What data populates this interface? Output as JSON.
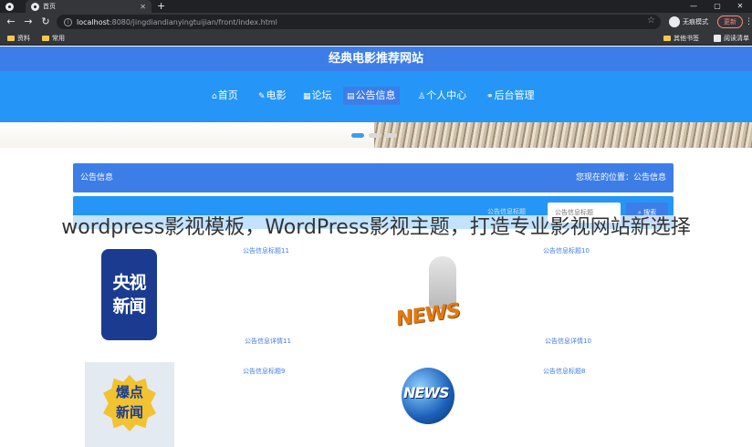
{
  "browser": {
    "tabs": [
      {
        "title": "",
        "active": false
      },
      {
        "title": "首页",
        "active": true
      }
    ],
    "new_tab_glyph": "+",
    "window_controls": [
      "—",
      "▢",
      "✕"
    ],
    "url_host": "localhost",
    "url_path": ":8080/jingdiandianyingtuijian/front/index.html",
    "profile_label": "无痕模式",
    "update_label": "更新",
    "bookmarks": [
      {
        "label": "资料",
        "icon": "folder-icon"
      },
      {
        "label": "常用",
        "icon": "folder-icon"
      }
    ],
    "bookmarks_right": [
      {
        "label": "其他书签",
        "icon": "folder-icon"
      },
      {
        "label": "阅读清单",
        "icon": "reading-list-icon"
      }
    ]
  },
  "site": {
    "title": "经典电影推荐网站",
    "nav": [
      {
        "label": "首页",
        "icon": "home-icon",
        "glyph": "⌂",
        "active": false
      },
      {
        "label": "电影",
        "icon": "film-icon",
        "glyph": "✎",
        "active": false
      },
      {
        "label": "论坛",
        "icon": "forum-icon",
        "glyph": "▦",
        "active": false
      },
      {
        "label": "公告信息",
        "icon": "notice-icon",
        "glyph": "▤",
        "active": true
      },
      {
        "label": "个人中心",
        "icon": "user-icon",
        "glyph": "♙",
        "active": false
      },
      {
        "label": "后台管理",
        "icon": "link-icon",
        "glyph": "⚭",
        "active": false
      }
    ]
  },
  "info_bar": {
    "section": "公告信息",
    "location": "您现在的位置：公告信息"
  },
  "search": {
    "label": "公告信息标题",
    "placeholder": "公告信息标题",
    "button": "搜索"
  },
  "watermark": "wordpress影视模板，WordPress影视主题，打造专业影视网站新选择",
  "notices": [
    {
      "title": "公告信息标题11",
      "detail": "公告信息详情11",
      "image": "cctv-news-logo",
      "image_text": [
        "央视",
        "新闻"
      ]
    },
    {
      "title": "公告信息标题10",
      "detail": "公告信息详情10",
      "image": "news-3d-figure",
      "image_text": [
        "NEWS"
      ]
    },
    {
      "title": "公告信息标题9",
      "detail": "",
      "image": "baodian-news-logo",
      "image_text": [
        "爆点",
        "新闻"
      ]
    },
    {
      "title": "公告信息标题8",
      "detail": "",
      "image": "news-globe",
      "image_text": [
        "NEWS"
      ]
    }
  ],
  "colors": {
    "title_bar": "#3d7de8",
    "nav_bar": "#2596f7",
    "link": "#3d7de8"
  }
}
